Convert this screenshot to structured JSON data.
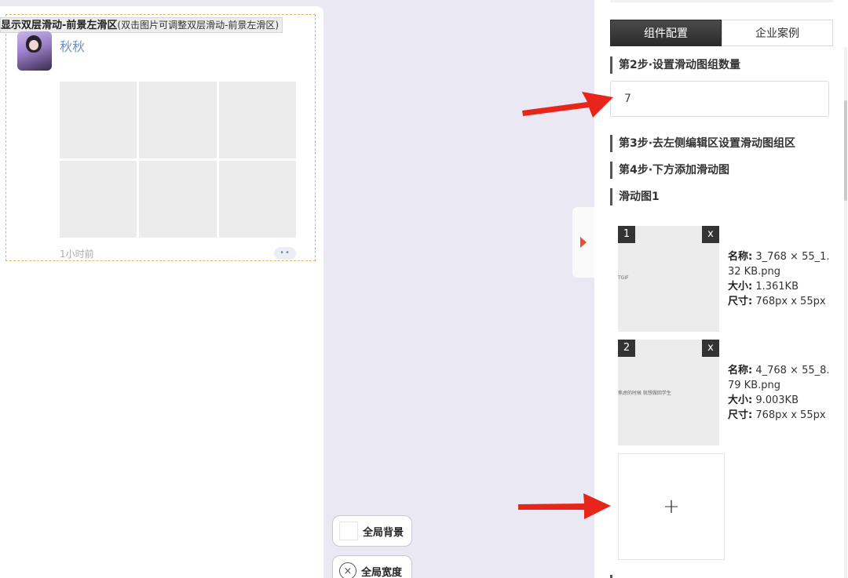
{
  "preview": {
    "module_title": "显示双层滑动-前景左滑区",
    "module_hint": "(双击图片可调整双层滑动-前景左滑区)",
    "username": "秋秋",
    "time": "1小时前",
    "more": "••",
    "grid_cells": 6
  },
  "float_buttons": {
    "global_bg_label": "全局背景",
    "global_width_label": "全局宽度",
    "close_glyph": "×"
  },
  "panel": {
    "tabs": [
      {
        "label": "组件配置",
        "active": true
      },
      {
        "label": "企业案例",
        "active": false
      }
    ],
    "step2_title": "第2步·设置滑动图组数量",
    "count_value": "7",
    "step3_title": "第3步·去左侧编辑区设置滑动图组区",
    "step4_title": "第4步·下方添加滑动图",
    "group_title": "滑动图1",
    "images": [
      {
        "index": "1",
        "close": "x",
        "caption": "TGIF",
        "name_label": "名称:",
        "name_value": "3_768 × 55_1.32 KB.png",
        "size_label": "大小:",
        "size_value": "1.361KB",
        "dim_label": "尺寸:",
        "dim_value": "768px x 55px"
      },
      {
        "index": "2",
        "close": "x",
        "caption": "焦虑的时候 就想做回学生",
        "name_label": "名称:",
        "name_value": "4_768 × 55_8.79 KB.png",
        "size_label": "大小:",
        "size_value": "9.003KB",
        "dim_label": "尺寸:",
        "dim_value": "768px x 55px"
      }
    ],
    "add_glyph": "+"
  },
  "colors": {
    "arrow": "#e8251a",
    "accent_dashed": "#e0b36a",
    "username": "#6d8fc4",
    "tab_active": "#2b2b2b"
  }
}
